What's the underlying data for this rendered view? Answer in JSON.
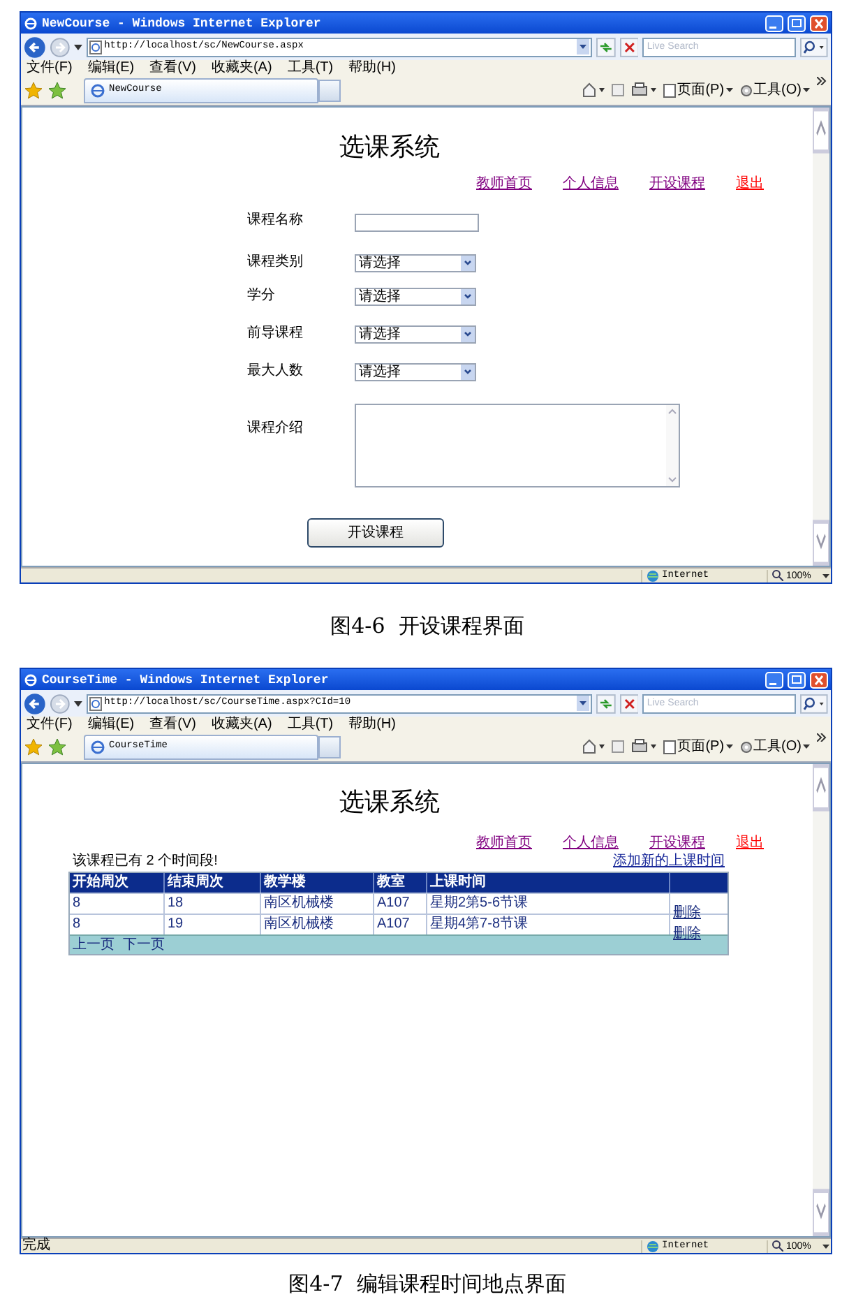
{
  "figures": [
    {
      "window": {
        "title": "NewCourse - Windows Internet Explorer",
        "address": "http://localhost/sc/NewCourse.aspx",
        "search_placeholder": "Live Search",
        "menu": [
          "文件(F)",
          "编辑(E)",
          "查看(V)",
          "收藏夹(A)",
          "工具(T)",
          "帮助(H)"
        ],
        "tab": "NewCourse",
        "toolbar": [
          "页面(P)",
          "工具(O)"
        ],
        "zone": "Internet",
        "zoom": "100%"
      },
      "page": {
        "kind": "form",
        "heading": "选课系统",
        "nav": [
          {
            "label": "教师首页",
            "color": "#800080"
          },
          {
            "label": "个人信息",
            "color": "#800080"
          },
          {
            "label": "开设课程",
            "color": "#800080"
          },
          {
            "label": "退出",
            "color": "#ff0000"
          }
        ],
        "fields": [
          {
            "label": "课程名称",
            "kind": "text"
          },
          {
            "label": "课程类别",
            "kind": "select",
            "value": "请选择"
          },
          {
            "label": "学分",
            "kind": "select",
            "value": "请选择"
          },
          {
            "label": "前导课程",
            "kind": "select",
            "value": "请选择"
          },
          {
            "label": "最大人数",
            "kind": "select",
            "value": "请选择"
          },
          {
            "label": "课程介绍",
            "kind": "textarea"
          }
        ],
        "submit": "开设课程"
      },
      "caption": "图4-6  开设课程界面"
    },
    {
      "window": {
        "title": "CourseTime - Windows Internet Explorer",
        "address": "http://localhost/sc/CourseTime.aspx?CId=10",
        "search_placeholder": "Live Search",
        "menu": [
          "文件(F)",
          "编辑(E)",
          "查看(V)",
          "收藏夹(A)",
          "工具(T)",
          "帮助(H)"
        ],
        "tab": "CourseTime",
        "toolbar": [
          "页面(P)",
          "工具(O)"
        ],
        "status": "完成",
        "zone": "Internet",
        "zoom": "100%"
      },
      "page": {
        "kind": "table",
        "heading": "选课系统",
        "nav": [
          {
            "label": "教师首页",
            "color": "#800080"
          },
          {
            "label": "个人信息",
            "color": "#800080"
          },
          {
            "label": "开设课程",
            "color": "#800080"
          },
          {
            "label": "退出",
            "color": "#ff0000"
          }
        ],
        "summary": "该课程已有 2 个时间段!",
        "add_link": "添加新的上课时间",
        "columns": [
          "开始周次",
          "结束周次",
          "教学楼",
          "教室",
          "上课时间"
        ],
        "rows": [
          {
            "cells": [
              "8",
              "18",
              "南区机械楼",
              "A107",
              "星期2第5-6节课"
            ],
            "action": "删除"
          },
          {
            "cells": [
              "8",
              "19",
              "南区机械楼",
              "A107",
              "星期4第7-8节课"
            ],
            "action": "删除"
          }
        ],
        "pager": [
          "上一页",
          "下一页"
        ]
      },
      "caption": "图4-7  编辑课程时间地点界面"
    }
  ]
}
